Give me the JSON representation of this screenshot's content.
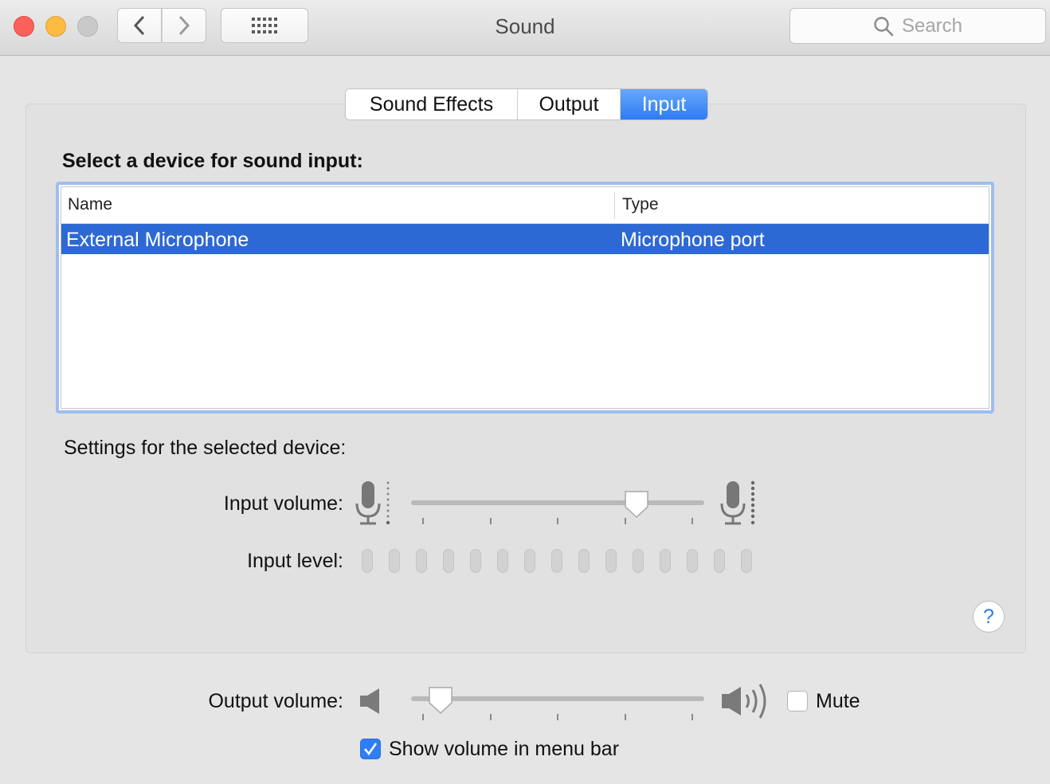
{
  "window": {
    "title": "Sound"
  },
  "toolbar": {
    "search_placeholder": "Search"
  },
  "tabs": [
    {
      "label": "Sound Effects",
      "selected": false
    },
    {
      "label": "Output",
      "selected": false
    },
    {
      "label": "Input",
      "selected": true
    }
  ],
  "input": {
    "heading": "Select a device for sound input:",
    "columns": [
      "Name",
      "Type"
    ],
    "devices": [
      {
        "name": "External Microphone",
        "type": "Microphone port",
        "selected": true
      }
    ],
    "settings_heading": "Settings for the selected device:",
    "input_volume_label": "Input volume:",
    "input_volume": 0.77,
    "input_level_label": "Input level:",
    "input_level_segments": 15,
    "input_level_active": 0
  },
  "output": {
    "output_volume_label": "Output volume:",
    "output_volume": 0.1,
    "mute_label": "Mute",
    "mute_checked": false,
    "show_volume_label": "Show volume in menu bar",
    "show_volume_checked": true
  },
  "help_label": "?",
  "colors": {
    "accent": "#2d7cf3",
    "selection": "#2d69d4",
    "close": "#fc605b",
    "minimize": "#fdbc40",
    "zoom": "#c9c9c9"
  }
}
